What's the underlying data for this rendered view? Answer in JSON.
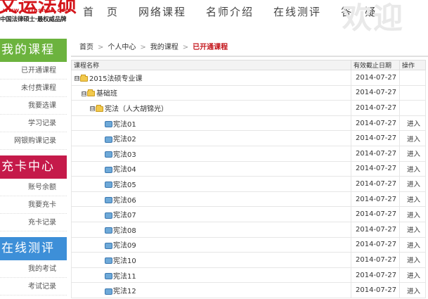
{
  "header": {
    "logo_title": "文运法硕",
    "logo_url": "www.wyfashuo.com",
    "logo_slogan": "中国法律硕士·最权威品牌",
    "watermark": "欢迎",
    "nav": [
      "首　页",
      "网络课程",
      "名师介绍",
      "在线测评",
      "答　疑"
    ]
  },
  "sidebar": {
    "sections": [
      {
        "title": "我的课程",
        "color": "#6cb33e",
        "items": [
          "已开通课程",
          "未付费课程",
          "我要选课",
          "学习记录",
          "网银购课记录"
        ]
      },
      {
        "title": "充卡中心",
        "color": "#c51a4a",
        "items": [
          "账号余额",
          "我要充卡",
          "充卡记录"
        ]
      },
      {
        "title": "在线测评",
        "color": "#3d8fd8",
        "items": [
          "我的考试",
          "考试记录"
        ]
      }
    ]
  },
  "breadcrumb": [
    "首页",
    "个人中心",
    "我的课程",
    "已开通课程"
  ],
  "table": {
    "headers": [
      "课程名称",
      "有效截止日期",
      "操作"
    ],
    "rows": [
      {
        "level": 0,
        "type": "folder",
        "toggle": "⊟",
        "name": "2015法硕专业课",
        "date": "2014-07-27",
        "op": ""
      },
      {
        "level": 1,
        "type": "folder",
        "toggle": "⊟",
        "name": "基础班",
        "date": "2014-07-27",
        "op": ""
      },
      {
        "level": 2,
        "type": "folder",
        "toggle": "⊟",
        "name": "宪法（人大胡锦光）",
        "date": "2014-07-27",
        "op": ""
      },
      {
        "level": 3,
        "type": "course",
        "toggle": "",
        "name": "宪法01",
        "date": "2014-07-27",
        "op": "进入"
      },
      {
        "level": 3,
        "type": "course",
        "toggle": "",
        "name": "宪法02",
        "date": "2014-07-27",
        "op": "进入"
      },
      {
        "level": 3,
        "type": "course",
        "toggle": "",
        "name": "宪法03",
        "date": "2014-07-27",
        "op": "进入"
      },
      {
        "level": 3,
        "type": "course",
        "toggle": "",
        "name": "宪法04",
        "date": "2014-07-27",
        "op": "进入"
      },
      {
        "level": 3,
        "type": "course",
        "toggle": "",
        "name": "宪法05",
        "date": "2014-07-27",
        "op": "进入"
      },
      {
        "level": 3,
        "type": "course",
        "toggle": "",
        "name": "宪法06",
        "date": "2014-07-27",
        "op": "进入"
      },
      {
        "level": 3,
        "type": "course",
        "toggle": "",
        "name": "宪法07",
        "date": "2014-07-27",
        "op": "进入"
      },
      {
        "level": 3,
        "type": "course",
        "toggle": "",
        "name": "宪法08",
        "date": "2014-07-27",
        "op": "进入"
      },
      {
        "level": 3,
        "type": "course",
        "toggle": "",
        "name": "宪法09",
        "date": "2014-07-27",
        "op": "进入"
      },
      {
        "level": 3,
        "type": "course",
        "toggle": "",
        "name": "宪法10",
        "date": "2014-07-27",
        "op": "进入"
      },
      {
        "level": 3,
        "type": "course",
        "toggle": "",
        "name": "宪法11",
        "date": "2014-07-27",
        "op": "进入"
      },
      {
        "level": 3,
        "type": "course",
        "toggle": "",
        "name": "宪法12",
        "date": "2014-07-27",
        "op": "进入"
      }
    ]
  }
}
